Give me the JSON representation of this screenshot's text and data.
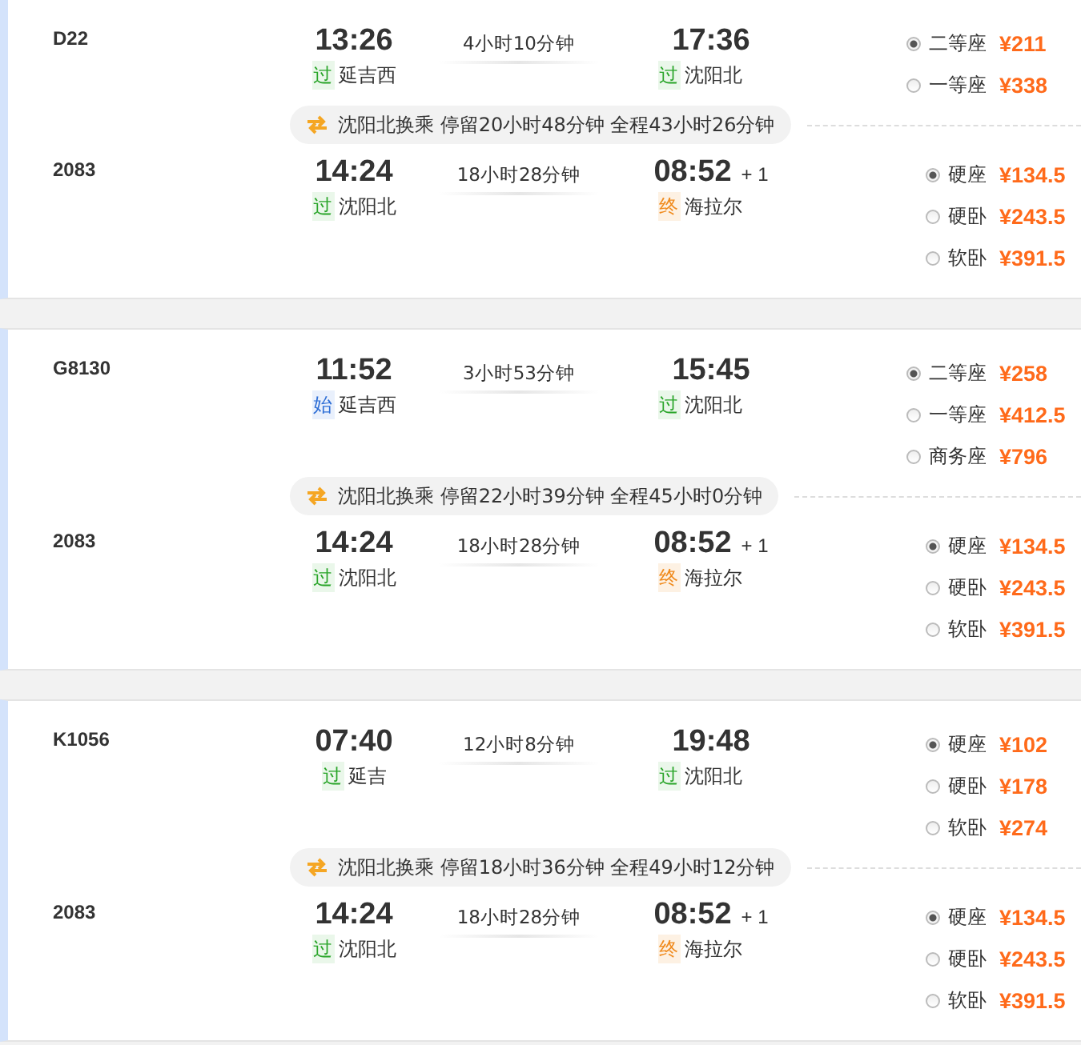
{
  "trips": [
    {
      "legs": [
        {
          "train": "D22",
          "depart_time": "13:26",
          "depart_mark": {
            "text": "过",
            "kind": "pass"
          },
          "depart_station": "延吉西",
          "duration": "4小时10分钟",
          "arrive_time": "17:36",
          "arrive_mark": {
            "text": "过",
            "kind": "pass"
          },
          "arrive_station": "沈阳北",
          "seats": [
            {
              "name": "二等座",
              "price": "¥211",
              "selected": true
            },
            {
              "name": "一等座",
              "price": "¥338",
              "selected": false
            }
          ]
        },
        {
          "train": "2083",
          "depart_time": "14:24",
          "depart_mark": {
            "text": "过",
            "kind": "pass"
          },
          "depart_station": "沈阳北",
          "duration": "18小时28分钟",
          "arrive_time": "08:52",
          "next_day": "+ 1",
          "arrive_mark": {
            "text": "终",
            "kind": "end"
          },
          "arrive_station": "海拉尔",
          "seats": [
            {
              "name": "硬座",
              "price": "¥134.5",
              "selected": true
            },
            {
              "name": "硬卧",
              "price": "¥243.5",
              "selected": false
            },
            {
              "name": "软卧",
              "price": "¥391.5",
              "selected": false
            }
          ]
        }
      ],
      "transfer": "沈阳北换乘 停留20小时48分钟 全程43小时26分钟"
    },
    {
      "legs": [
        {
          "train": "G8130",
          "depart_time": "11:52",
          "depart_mark": {
            "text": "始",
            "kind": "start"
          },
          "depart_station": "延吉西",
          "duration": "3小时53分钟",
          "arrive_time": "15:45",
          "arrive_mark": {
            "text": "过",
            "kind": "pass"
          },
          "arrive_station": "沈阳北",
          "seats": [
            {
              "name": "二等座",
              "price": "¥258",
              "selected": true
            },
            {
              "name": "一等座",
              "price": "¥412.5",
              "selected": false
            },
            {
              "name": "商务座",
              "price": "¥796",
              "selected": false
            }
          ]
        },
        {
          "train": "2083",
          "depart_time": "14:24",
          "depart_mark": {
            "text": "过",
            "kind": "pass"
          },
          "depart_station": "沈阳北",
          "duration": "18小时28分钟",
          "arrive_time": "08:52",
          "next_day": "+ 1",
          "arrive_mark": {
            "text": "终",
            "kind": "end"
          },
          "arrive_station": "海拉尔",
          "seats": [
            {
              "name": "硬座",
              "price": "¥134.5",
              "selected": true
            },
            {
              "name": "硬卧",
              "price": "¥243.5",
              "selected": false
            },
            {
              "name": "软卧",
              "price": "¥391.5",
              "selected": false
            }
          ]
        }
      ],
      "transfer": "沈阳北换乘 停留22小时39分钟 全程45小时0分钟"
    },
    {
      "legs": [
        {
          "train": "K1056",
          "depart_time": "07:40",
          "depart_mark": {
            "text": "过",
            "kind": "pass"
          },
          "depart_station": "延吉",
          "duration": "12小时8分钟",
          "arrive_time": "19:48",
          "arrive_mark": {
            "text": "过",
            "kind": "pass"
          },
          "arrive_station": "沈阳北",
          "seats": [
            {
              "name": "硬座",
              "price": "¥102",
              "selected": true
            },
            {
              "name": "硬卧",
              "price": "¥178",
              "selected": false
            },
            {
              "name": "软卧",
              "price": "¥274",
              "selected": false
            }
          ]
        },
        {
          "train": "2083",
          "depart_time": "14:24",
          "depart_mark": {
            "text": "过",
            "kind": "pass"
          },
          "depart_station": "沈阳北",
          "duration": "18小时28分钟",
          "arrive_time": "08:52",
          "next_day": "+ 1",
          "arrive_mark": {
            "text": "终",
            "kind": "end"
          },
          "arrive_station": "海拉尔",
          "seats": [
            {
              "name": "硬座",
              "price": "¥134.5",
              "selected": true
            },
            {
              "name": "硬卧",
              "price": "¥243.5",
              "selected": false
            },
            {
              "name": "软卧",
              "price": "¥391.5",
              "selected": false
            }
          ]
        }
      ],
      "transfer": "沈阳北换乘 停留18小时36分钟 全程49小时12分钟"
    }
  ]
}
